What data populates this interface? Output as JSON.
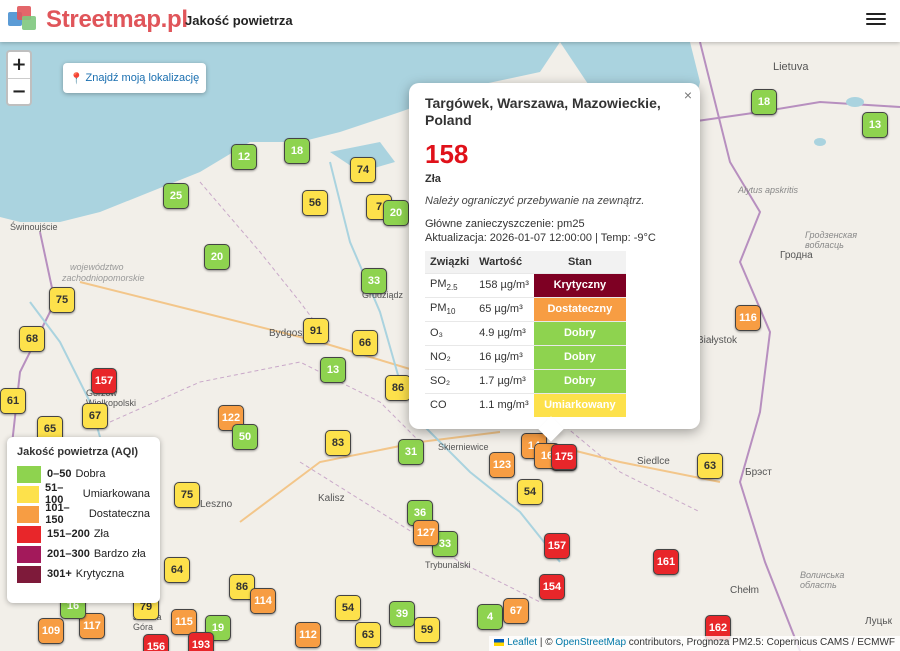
{
  "header": {
    "brand": "Streetmap.pl",
    "subtitle": "Jakość powietrza"
  },
  "controls": {
    "zoom_in": "+",
    "zoom_out": "−",
    "locate_label": "Znajdź moją lokalizację"
  },
  "map_labels": {
    "lietuva": "Lietuva",
    "swinoujscie": "Świnoujście",
    "zachodnio": [
      "województwo",
      "zachodniopomorskie"
    ],
    "bydgoszcz": "Bydgoszcz",
    "grudziadz": "Grudziądz",
    "kalisz": "Kalisz",
    "leszno": "Leszno",
    "skierniewice": "Skierniewice",
    "siedlce": "Siedlce",
    "brest": "Брэст",
    "hrodna": "Гродна",
    "bialystok": "Białystok",
    "chelm": "Chełm",
    "lutsk": "Луцьк",
    "trybunalski": "Trybunalski",
    "gorzow_wielkopolski": "Gorzów Wielkopolski",
    "jelenia_gora": "Jelenia Góra",
    "alytus": "Alytus apskritis",
    "hrodzenskaja": "Гродзенская вобласць",
    "volynska": "Волинська область"
  },
  "markers": [
    {
      "v": "18",
      "c": "good"
    },
    {
      "v": "13",
      "c": "good"
    },
    {
      "v": "12",
      "c": "good"
    },
    {
      "v": "18",
      "c": "good"
    },
    {
      "v": "74",
      "c": "mod"
    },
    {
      "v": "56",
      "c": "mod"
    },
    {
      "v": "7",
      "c": "mod"
    },
    {
      "v": "20",
      "c": "good"
    },
    {
      "v": "25",
      "c": "good"
    },
    {
      "v": "20",
      "c": "good"
    },
    {
      "v": "33",
      "c": "good"
    },
    {
      "v": "75",
      "c": "mod"
    },
    {
      "v": "68",
      "c": "mod"
    },
    {
      "v": "91",
      "c": "mod"
    },
    {
      "v": "66",
      "c": "mod"
    },
    {
      "v": "13",
      "c": "good"
    },
    {
      "v": "157",
      "c": "bad"
    },
    {
      "v": "86",
      "c": "mod"
    },
    {
      "v": "61",
      "c": "mod"
    },
    {
      "v": "67",
      "c": "mod"
    },
    {
      "v": "122",
      "c": "usg"
    },
    {
      "v": "50",
      "c": "good"
    },
    {
      "v": "65",
      "c": "mod"
    },
    {
      "v": "83",
      "c": "mod"
    },
    {
      "v": "31",
      "c": "good"
    },
    {
      "v": "123",
      "c": "usg"
    },
    {
      "v": "175",
      "c": "bad"
    },
    {
      "v": "75",
      "c": "mod"
    },
    {
      "v": "36",
      "c": "good"
    },
    {
      "v": "54",
      "c": "mod"
    },
    {
      "v": "33",
      "c": "good"
    },
    {
      "v": "157",
      "c": "bad"
    },
    {
      "v": "161",
      "c": "bad"
    },
    {
      "v": "63",
      "c": "mod"
    },
    {
      "v": "116",
      "c": "usg"
    },
    {
      "v": "64",
      "c": "mod"
    },
    {
      "v": "86",
      "c": "mod"
    },
    {
      "v": "114",
      "c": "usg"
    },
    {
      "v": "154",
      "c": "bad"
    },
    {
      "v": "54",
      "c": "mod"
    },
    {
      "v": "39",
      "c": "good"
    },
    {
      "v": "4",
      "c": "good"
    },
    {
      "v": "67",
      "c": "usg"
    },
    {
      "v": "109",
      "c": "usg"
    },
    {
      "v": "117",
      "c": "usg"
    },
    {
      "v": "16",
      "c": "good"
    },
    {
      "v": "79",
      "c": "mod"
    },
    {
      "v": "115",
      "c": "usg"
    },
    {
      "v": "19",
      "c": "good"
    },
    {
      "v": "112",
      "c": "usg"
    },
    {
      "v": "63",
      "c": "mod"
    },
    {
      "v": "59",
      "c": "mod"
    },
    {
      "v": "162",
      "c": "bad"
    },
    {
      "v": "156",
      "c": "bad"
    },
    {
      "v": "193",
      "c": "bad"
    },
    {
      "v": "14",
      "c": "usg"
    },
    {
      "v": "16",
      "c": "usg"
    },
    {
      "v": "127",
      "c": "usg"
    }
  ],
  "popup": {
    "close": "×",
    "location": "Targówek, Warszawa, Mazowieckie, Poland",
    "aqi": "158",
    "category": "Zła",
    "advice": "Należy ograniczyć przebywanie na zewnątrz.",
    "main_pollutant": "Główne zanieczyszczenie: pm25",
    "update": "Aktualizacja: 2026-01-07 12:00:00 | Temp: -9°C",
    "headers": [
      "Związki",
      "Wartość",
      "Stan"
    ],
    "rows": [
      {
        "name": "PM",
        "sub": "2.5",
        "value": "158 µg/m³",
        "status": "Krytyczny",
        "color": "#7e0023"
      },
      {
        "name": "PM",
        "sub": "10",
        "value": "65 µg/m³",
        "status": "Dostateczny",
        "color": "#f79d43"
      },
      {
        "name": "O₃",
        "sub": "",
        "value": "4.9 µg/m³",
        "status": "Dobry",
        "color": "#8ed34f"
      },
      {
        "name": "NO₂",
        "sub": "",
        "value": "16 µg/m³",
        "status": "Dobry",
        "color": "#8ed34f"
      },
      {
        "name": "SO₂",
        "sub": "",
        "value": "1.7 µg/m³",
        "status": "Dobry",
        "color": "#8ed34f"
      },
      {
        "name": "CO",
        "sub": "",
        "value": "1.1 mg/m³",
        "status": "Umiarkowany",
        "color": "#fde14b"
      }
    ]
  },
  "legend": {
    "title": "Jakość powietrza (AQI)",
    "items": [
      {
        "range": "0–50",
        "label": "Dobra",
        "color": "#8ed34f"
      },
      {
        "range": "51–100",
        "label": "Umiarkowana",
        "color": "#fde14b"
      },
      {
        "range": "101–150",
        "label": "Dostateczna",
        "color": "#f79d43"
      },
      {
        "range": "151–200",
        "label": "Zła",
        "color": "#e8262a"
      },
      {
        "range": "201–300",
        "label": "Bardzo zła",
        "color": "#a3195b"
      },
      {
        "range": "301+",
        "label": "Krytyczna",
        "color": "#7e1a3a"
      }
    ]
  },
  "attribution": {
    "leaflet": "Leaflet",
    "sep": " | © ",
    "osm": "OpenStreetMap",
    "rest": " contributors, Prognoza PM2.5: Copernicus CAMS / ECMWF"
  }
}
